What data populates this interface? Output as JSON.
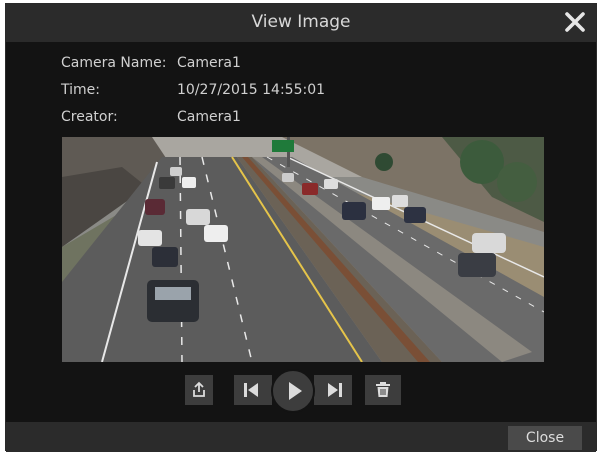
{
  "dialog": {
    "title": "View Image",
    "close_button_label": "Close"
  },
  "info": {
    "camera_name_label": "Camera Name:",
    "camera_name_value": "Camera1",
    "time_label": "Time:",
    "time_value": "10/27/2015 14:55:01",
    "creator_label": "Creator:",
    "creator_value": "Camera1"
  },
  "controls": [
    {
      "name": "export-button",
      "icon": "export-icon"
    },
    {
      "name": "previous-button",
      "icon": "skip-previous-icon"
    },
    {
      "name": "play-button",
      "icon": "play-icon"
    },
    {
      "name": "next-button",
      "icon": "skip-next-icon"
    },
    {
      "name": "delete-button",
      "icon": "trash-icon"
    }
  ],
  "colors": {
    "dialog_bg": "#131313",
    "bar_bg": "#2b2b2b",
    "button_bg": "#3d3d3d",
    "text": "#d0d0d0"
  }
}
